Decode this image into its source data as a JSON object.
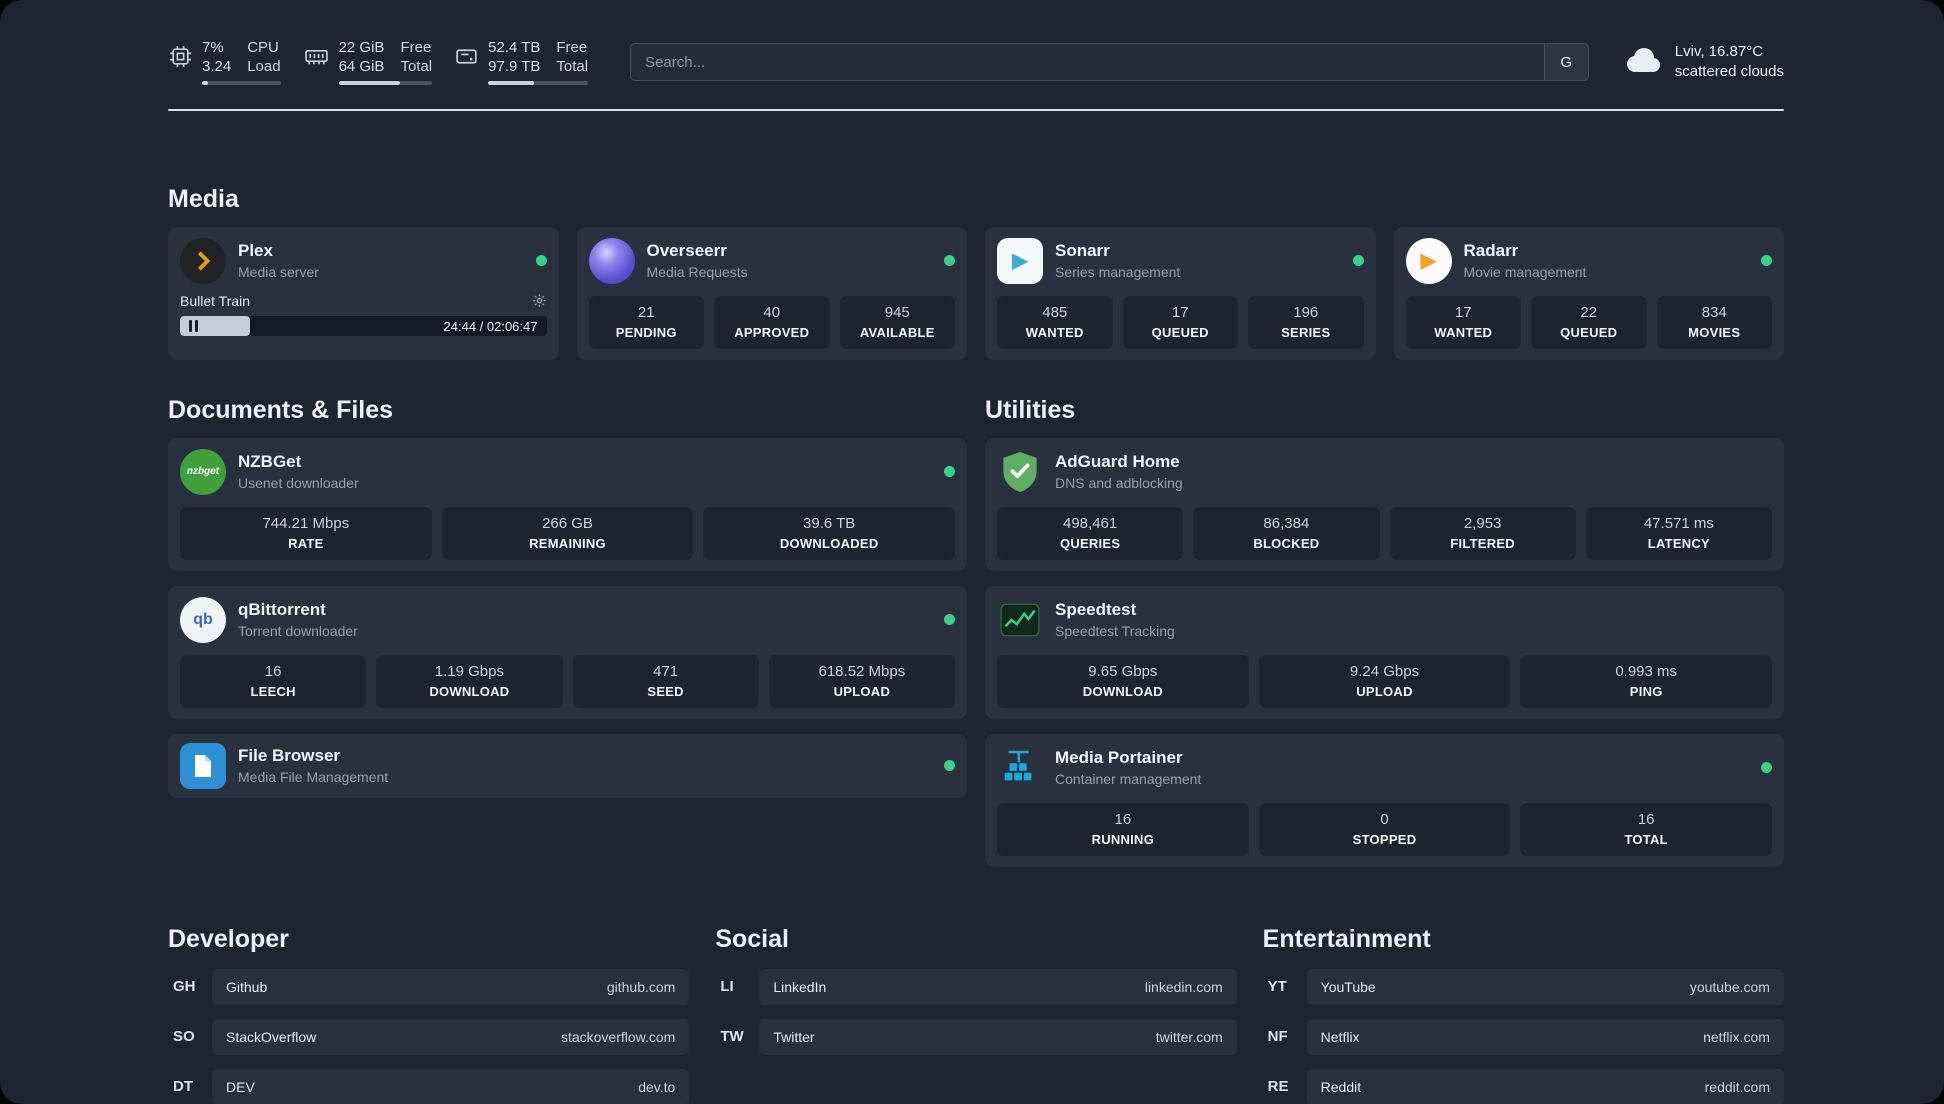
{
  "topbar": {
    "cpu": {
      "percent": "7%",
      "load_value": "3.24",
      "unit_top": "CPU",
      "unit_bottom": "Load",
      "bar_percent": 7
    },
    "memory": {
      "free_value": "22 GiB",
      "total_value": "64 GiB",
      "free_label": "Free",
      "total_label": "Total",
      "bar_percent": 66
    },
    "disk": {
      "free_value": "52.4 TB",
      "total_value": "97.9 TB",
      "free_label": "Free",
      "total_label": "Total",
      "bar_percent": 46
    },
    "search": {
      "placeholder": "Search...",
      "button": "G"
    },
    "weather": {
      "location": "Lviv, 16.87°C",
      "condition": "scattered clouds"
    }
  },
  "media": {
    "title": "Media",
    "cards": [
      {
        "name": "Plex",
        "desc": "Media server",
        "now_playing": "Bullet Train",
        "time": "24:44 / 02:06:47",
        "progress_percent": 19
      },
      {
        "name": "Overseerr",
        "desc": "Media Requests",
        "stats": [
          {
            "v": "21",
            "l": "PENDING"
          },
          {
            "v": "40",
            "l": "APPROVED"
          },
          {
            "v": "945",
            "l": "AVAILABLE"
          }
        ]
      },
      {
        "name": "Sonarr",
        "desc": "Series management",
        "stats": [
          {
            "v": "485",
            "l": "WANTED"
          },
          {
            "v": "17",
            "l": "QUEUED"
          },
          {
            "v": "196",
            "l": "SERIES"
          }
        ]
      },
      {
        "name": "Radarr",
        "desc": "Movie management",
        "stats": [
          {
            "v": "17",
            "l": "WANTED"
          },
          {
            "v": "22",
            "l": "QUEUED"
          },
          {
            "v": "834",
            "l": "MOVIES"
          }
        ]
      }
    ]
  },
  "documents": {
    "title": "Documents & Files",
    "cards": [
      {
        "name": "NZBGet",
        "desc": "Usenet downloader",
        "stats": [
          {
            "v": "744.21 Mbps",
            "l": "RATE"
          },
          {
            "v": "266 GB",
            "l": "REMAINING"
          },
          {
            "v": "39.6 TB",
            "l": "DOWNLOADED"
          }
        ]
      },
      {
        "name": "qBittorrent",
        "desc": "Torrent downloader",
        "stats": [
          {
            "v": "16",
            "l": "LEECH"
          },
          {
            "v": "1.19 Gbps",
            "l": "DOWNLOAD"
          },
          {
            "v": "471",
            "l": "SEED"
          },
          {
            "v": "618.52 Mbps",
            "l": "UPLOAD"
          }
        ]
      },
      {
        "name": "File Browser",
        "desc": "Media File Management",
        "stats": []
      }
    ]
  },
  "utilities": {
    "title": "Utilities",
    "cards": [
      {
        "name": "AdGuard Home",
        "desc": "DNS and adblocking",
        "stats": [
          {
            "v": "498,461",
            "l": "QUERIES"
          },
          {
            "v": "86,384",
            "l": "BLOCKED"
          },
          {
            "v": "2,953",
            "l": "FILTERED"
          },
          {
            "v": "47.571 ms",
            "l": "LATENCY"
          }
        ]
      },
      {
        "name": "Speedtest",
        "desc": "Speedtest Tracking",
        "stats": [
          {
            "v": "9.65 Gbps",
            "l": "DOWNLOAD"
          },
          {
            "v": "9.24 Gbps",
            "l": "UPLOAD"
          },
          {
            "v": "0.993 ms",
            "l": "PING"
          }
        ]
      },
      {
        "name": "Media Portainer",
        "desc": "Container management",
        "stats": [
          {
            "v": "16",
            "l": "RUNNING"
          },
          {
            "v": "0",
            "l": "STOPPED"
          },
          {
            "v": "16",
            "l": "TOTAL"
          }
        ]
      }
    ]
  },
  "links": {
    "developer": {
      "title": "Developer",
      "items": [
        {
          "abbr": "GH",
          "name": "Github",
          "url": "github.com"
        },
        {
          "abbr": "SO",
          "name": "StackOverflow",
          "url": "stackoverflow.com"
        },
        {
          "abbr": "DT",
          "name": "DEV",
          "url": "dev.to"
        }
      ]
    },
    "social": {
      "title": "Social",
      "items": [
        {
          "abbr": "LI",
          "name": "LinkedIn",
          "url": "linkedin.com"
        },
        {
          "abbr": "TW",
          "name": "Twitter",
          "url": "twitter.com"
        }
      ]
    },
    "entertainment": {
      "title": "Entertainment",
      "items": [
        {
          "abbr": "YT",
          "name": "YouTube",
          "url": "youtube.com"
        },
        {
          "abbr": "NF",
          "name": "Netflix",
          "url": "netflix.com"
        },
        {
          "abbr": "RE",
          "name": "Reddit",
          "url": "reddit.com"
        }
      ]
    }
  },
  "icons": {
    "nzbget_text": "nzbget",
    "qbittorrent_text": "qb",
    "sonarr_glyph": "▶",
    "radarr_glyph": "▶"
  },
  "colors": {
    "status_online": "#37d287",
    "plex_accent": "#e5a00d",
    "overseerr_purple": "#5a4fcf",
    "sonarr_blue": "#3fa9dc",
    "radarr_orange": "#f0a42b",
    "nzbget_green": "#3ea13e",
    "qbittorrent_blue": "#356ab0",
    "filebrowser_blue": "#2f8fd4",
    "adguard_green": "#5fae63",
    "speedtest_green": "#3ad07f",
    "portainer_blue": "#1ba8e0",
    "page_background": "#1d2533"
  }
}
